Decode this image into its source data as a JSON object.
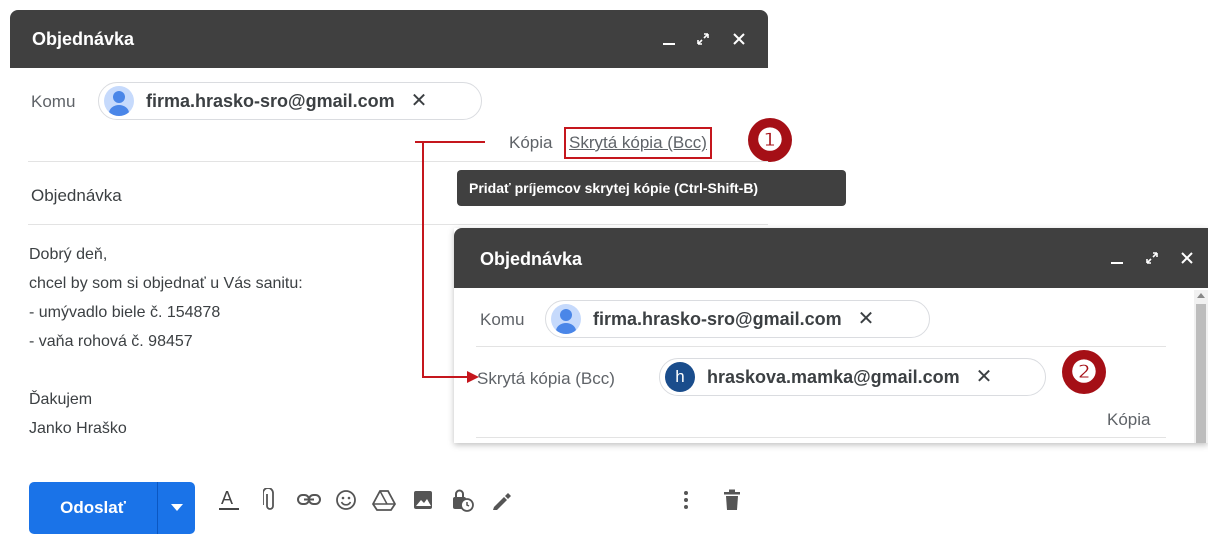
{
  "window1": {
    "title": "Objednávka",
    "to_label": "Komu",
    "to_email": "firma.hrasko-sro@gmail.com",
    "cc_link": "Kópia",
    "bcc_link": "Skrytá kópia (Bcc)",
    "tooltip": "Pridať príjemcov skrytej kópie (Ctrl-Shift-B)",
    "subject": "Objednávka",
    "body_lines": [
      "Dobrý deň,",
      "chcel by som si objednať u Vás sanitu:",
      "- umývadlo biele č. 154878",
      "- vaňa rohová č. 98457",
      "",
      "Ďakujem",
      "Janko Hraško"
    ],
    "send_label": "Odoslať",
    "toolbar_icons": [
      "text-format-icon",
      "attach-icon",
      "link-icon",
      "emoji-icon",
      "drive-icon",
      "photo-icon",
      "confidential-mode-icon",
      "signature-icon",
      "more-options-icon",
      "trash-icon"
    ]
  },
  "window2": {
    "title": "Objednávka",
    "to_label": "Komu",
    "to_email": "firma.hrasko-sro@gmail.com",
    "bcc_label": "Skrytá kópia (Bcc)",
    "bcc_avatar_letter": "h",
    "bcc_email": "hraskova.mamka@gmail.com",
    "cc_link": "Kópia"
  },
  "callouts": [
    "❶",
    "❷"
  ],
  "colors": {
    "titlebar": "#404040",
    "send_button": "#1a73e8",
    "badge": "#a50f16",
    "arrow": "#c5161d",
    "avatar_blue": "#1a73e8",
    "avatar_dark": "#1a4d8c"
  }
}
